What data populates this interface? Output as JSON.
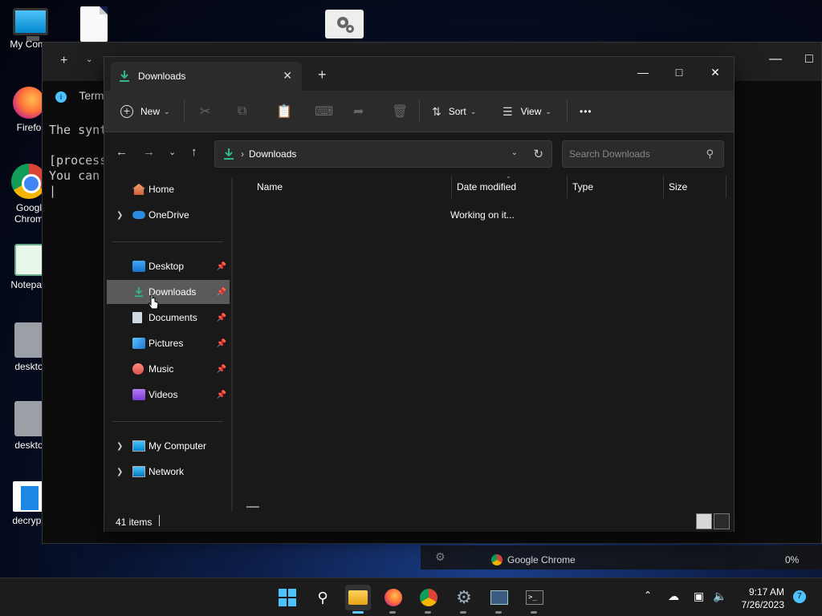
{
  "desktop": {
    "icons": [
      {
        "label": "My Comp",
        "icon": "monitor-icon"
      },
      {
        "label": "",
        "icon": "file-icon"
      },
      {
        "label": "",
        "icon": "settings-file-icon"
      },
      {
        "label": "Firefo",
        "icon": "firefox-icon"
      },
      {
        "label": "Googl",
        "label2": "Chrom",
        "icon": "chrome-icon"
      },
      {
        "label": "Notepad",
        "icon": "notepad-icon"
      },
      {
        "label": "deskto",
        "icon": "settings-file-icon"
      },
      {
        "label": "deskto",
        "icon": "settings-file-icon"
      },
      {
        "label": "decrypt",
        "icon": "decrypt-icon"
      }
    ]
  },
  "terminal": {
    "tab_label": "Term",
    "lines": [
      "The synt",
      "",
      "[process",
      "You can"
    ]
  },
  "explorer": {
    "tab_label": "Downloads",
    "toolbar": {
      "new_label": "New",
      "sort_label": "Sort",
      "view_label": "View",
      "more_label": "•••"
    },
    "address": {
      "path": "Downloads"
    },
    "search": {
      "placeholder": "Search Downloads"
    },
    "nav": {
      "home": "Home",
      "onedrive": "OneDrive",
      "desktop": "Desktop",
      "downloads": "Downloads",
      "documents": "Documents",
      "pictures": "Pictures",
      "music": "Music",
      "videos": "Videos",
      "my_computer": "My Computer",
      "network": "Network"
    },
    "columns": {
      "name": "Name",
      "date_modified": "Date modified",
      "type": "Type",
      "size": "Size"
    },
    "content_status": "Working on it...",
    "status_bar": {
      "item_count": "41 items"
    }
  },
  "background_panel": {
    "app_label": "Google Chrome",
    "percent": "0%"
  },
  "taskbar": {
    "time": "9:17 AM",
    "date": "7/26/2023",
    "notification_count": "7"
  },
  "colors": {
    "accent": "#4cc2ff",
    "download_green": "#2fb88b",
    "window_bg": "#191919",
    "toolbar_bg": "#2b2b2b",
    "selected_nav": "#5a5a5a"
  }
}
